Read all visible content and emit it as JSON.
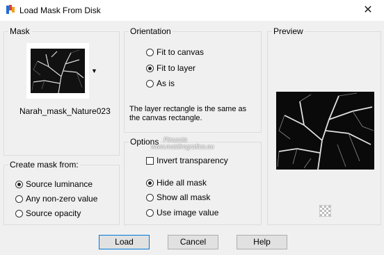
{
  "window": {
    "title": "Load Mask From Disk"
  },
  "mask": {
    "legend": "Mask",
    "name": "Narah_mask_Nature023"
  },
  "orientation": {
    "legend": "Orientation",
    "options": [
      "Fit to canvas",
      "Fit to layer",
      "As is"
    ],
    "selected": "Fit to layer",
    "info_line1": "The layer rectangle is the same as",
    "info_line2": "the canvas rectangle."
  },
  "preview": {
    "legend": "Preview"
  },
  "create": {
    "legend": "Create mask from:",
    "options": [
      "Source luminance",
      "Any non-zero value",
      "Source opacity"
    ],
    "selected": "Source luminance"
  },
  "options": {
    "legend": "Options",
    "invert_label": "Invert transparency",
    "invert_checked": false,
    "choices": [
      "Hide all mask",
      "Show all mask",
      "Use image value"
    ],
    "selected": "Hide all mask"
  },
  "watermark": {
    "line1": "Pinuccia",
    "line2": "www.maidiregrafica.eu"
  },
  "buttons": {
    "load": "Load",
    "cancel": "Cancel",
    "help": "Help"
  }
}
